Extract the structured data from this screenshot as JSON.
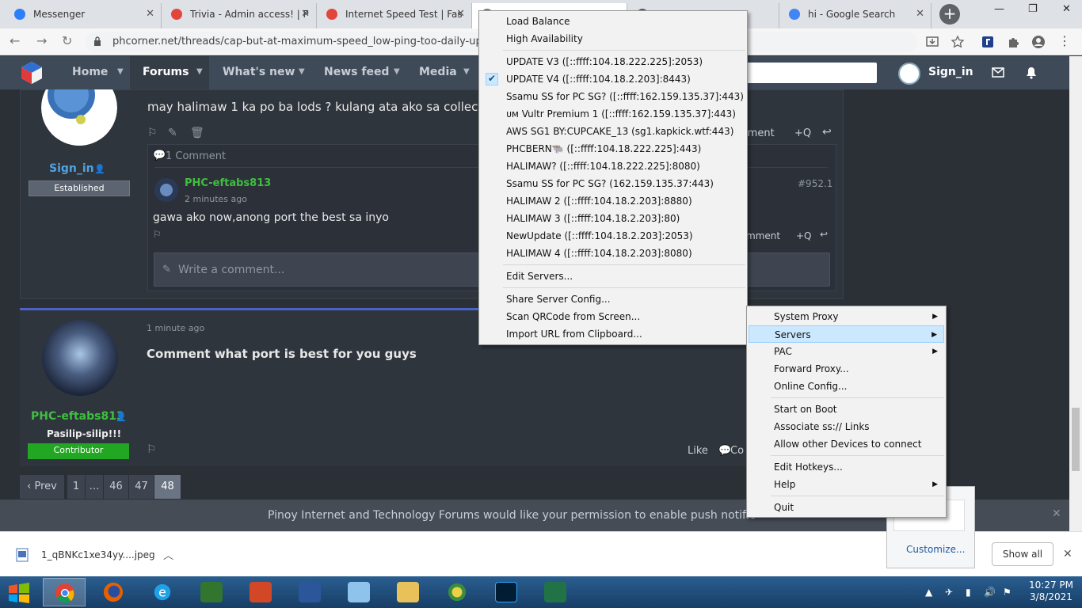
{
  "browser": {
    "tabs": [
      {
        "title": "Messenger",
        "color": "#2d7ff9"
      },
      {
        "title": "Trivia - Admin access! | P",
        "color": "#e2453c"
      },
      {
        "title": "Internet Speed Test | Fas",
        "color": "#e2453c"
      },
      {
        "title": "",
        "color": "#777777"
      },
      {
        "title": "",
        "color": "#555555"
      },
      {
        "title": "hi - Google Search",
        "color": "#4285f4"
      }
    ],
    "tab_close": "✕",
    "new_tab": "+",
    "window_controls": [
      "—",
      "❐",
      "✕"
    ],
    "url": "phcorner.net/threads/cap-but-at-maximum-speed_low-ping-too-daily-upd"
  },
  "site": {
    "nav": [
      {
        "label": "Home"
      },
      {
        "label": "Forums"
      },
      {
        "label": "What's new"
      },
      {
        "label": "News feed"
      },
      {
        "label": "Media"
      }
    ],
    "user": "Sign_in"
  },
  "post1": {
    "text": "may halimaw 1 ka po ba lods ? kulang ata ako sa collect",
    "author": "Sign_in",
    "badge": "Established",
    "comment_count": "1 Comment",
    "comment_right": "mment",
    "quote_label": "+Q",
    "comment": {
      "author": "PHC-eftabs813",
      "time": "2 minutes ago",
      "num": "#952.1",
      "text": "gawa ako now,anong port the best sa inyo"
    },
    "write_placeholder": "Write a comment..."
  },
  "post2": {
    "time": "1 minute ago",
    "text": "Comment what port is best for you guys",
    "author": "PHC-eftabs813",
    "title": "Pasilip-silip!!!",
    "badge": "Contributor",
    "like": "Like",
    "comment_partial": "Co"
  },
  "pagination": [
    "‹ Prev",
    "1",
    "…",
    "46",
    "47",
    "48"
  ],
  "notification": "Pinoy Internet and Technology Forums would like your permission to enable push notific",
  "download": {
    "file": "1_qBNKc1xe34yy....jpeg",
    "show_all": "Show all"
  },
  "servers_menu": {
    "items": [
      {
        "label": "Load Balance"
      },
      {
        "label": "High Availability"
      },
      {
        "sep": true
      },
      {
        "label": "UPDATE V3 ([::ffff:104.18.222.225]:2053)"
      },
      {
        "label": "UPDATE V4 ([::ffff:104.18.2.203]:8443)",
        "checked": true
      },
      {
        "label": "Ssamu SS for PC SG? ([::ffff:162.159.135.37]:443)"
      },
      {
        "label": "ᴜᴍ Vultr Premium 1 ([::ffff:162.159.135.37]:443)"
      },
      {
        "label": "AWS SG1 BY:CUPCAKE_13 (sg1.kapkick.wtf:443)"
      },
      {
        "label": "PHCBERN🐃 ([::ffff:104.18.222.225]:443)"
      },
      {
        "label": "HALIMAW? ([::ffff:104.18.222.225]:8080)"
      },
      {
        "label": "Ssamu SS for PC SG? (162.159.135.37:443)"
      },
      {
        "label": "HALIMAW 2 ([::ffff:104.18.2.203]:8880)"
      },
      {
        "label": "HALIMAW 3 ([::ffff:104.18.2.203]:80)"
      },
      {
        "label": "NewUpdate ([::ffff:104.18.2.203]:2053)"
      },
      {
        "label": "HALIMAW 4 ([::ffff:104.18.2.203]:8080)"
      },
      {
        "sep": true
      },
      {
        "label": "Edit Servers..."
      },
      {
        "sep": true
      },
      {
        "label": "Share Server Config..."
      },
      {
        "label": "Scan QRCode from Screen..."
      },
      {
        "label": "Import URL from Clipboard..."
      }
    ]
  },
  "main_menu": {
    "items": [
      {
        "label": "System Proxy",
        "submenu": true
      },
      {
        "label": "Servers",
        "submenu": true,
        "highlight": true
      },
      {
        "label": "PAC",
        "submenu": true
      },
      {
        "label": "Forward Proxy..."
      },
      {
        "label": "Online Config..."
      },
      {
        "sep": true
      },
      {
        "label": "Start on Boot"
      },
      {
        "label": "Associate ss:// Links"
      },
      {
        "label": "Allow other Devices to connect"
      },
      {
        "sep": true
      },
      {
        "label": "Edit Hotkeys..."
      },
      {
        "label": "Help",
        "submenu": true
      },
      {
        "sep": true
      },
      {
        "label": "Quit"
      }
    ]
  },
  "tray": {
    "customize": "Customize...",
    "time": "10:27 PM",
    "date": "3/8/2021"
  },
  "colors": {
    "green_user": "#3fbf3f",
    "blue_user": "#4fa3e0",
    "contributor": "#22a722",
    "established": "#5b6470"
  }
}
